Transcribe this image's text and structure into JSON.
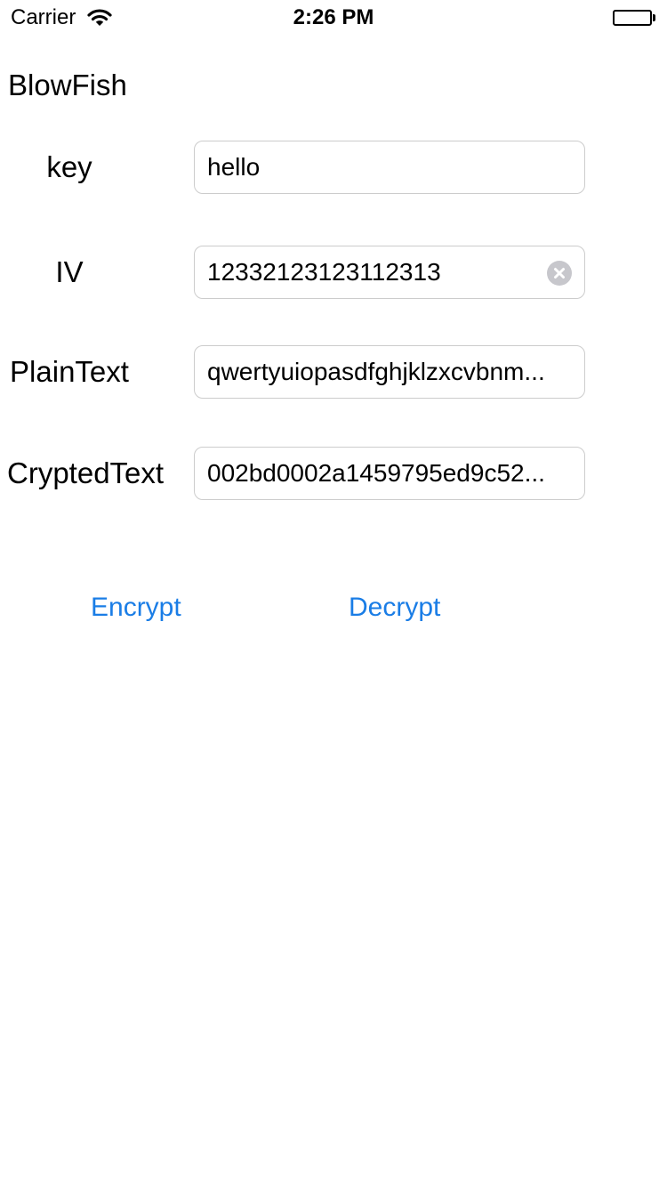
{
  "status_bar": {
    "carrier": "Carrier",
    "time": "2:26 PM",
    "wifi_icon": "wifi-icon",
    "battery_icon": "battery-icon"
  },
  "app": {
    "title": "BlowFish"
  },
  "form": {
    "key": {
      "label": "key",
      "value": "hello"
    },
    "iv": {
      "label": "IV",
      "value": "12332123123112313",
      "clear_icon": "clear-icon"
    },
    "plaintext": {
      "label": "PlainText",
      "value": "qwertyuiopasdfghjklzxcvbnm..."
    },
    "cryptedtext": {
      "label": "CryptedText",
      "value": "002bd0002a1459795ed9c52..."
    }
  },
  "actions": {
    "encrypt_label": "Encrypt",
    "decrypt_label": "Decrypt"
  },
  "colors": {
    "accent": "#1a7de6",
    "field_border": "#cccccc",
    "clear_icon": "#c7c7cc"
  }
}
